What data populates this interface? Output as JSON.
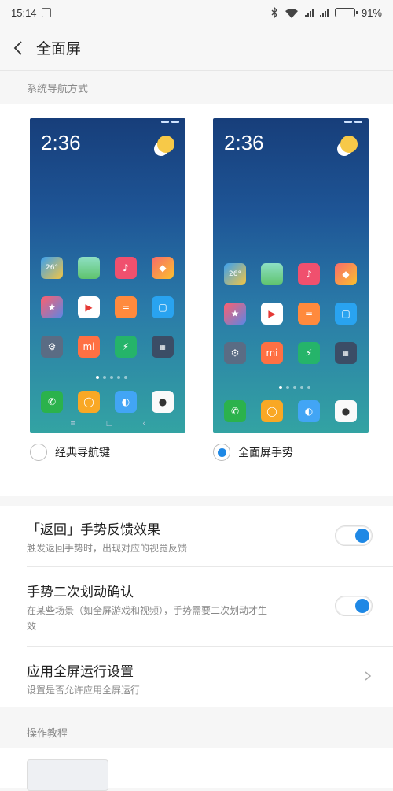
{
  "status_bar": {
    "time": "15:14",
    "battery": "91%",
    "battery_level": 0.91
  },
  "header": {
    "title": "全面屏"
  },
  "nav_section": {
    "label": "系统导航方式",
    "preview_time": "2:36",
    "app_badge_temp": "26°",
    "options": [
      {
        "label": "经典导航键",
        "selected": false
      },
      {
        "label": "全面屏手势",
        "selected": true
      }
    ]
  },
  "settings": [
    {
      "title": "「返回」手势反馈效果",
      "subtitle": "触发返回手势时，出现对应的视觉反馈",
      "toggle": true
    },
    {
      "title": "手势二次划动确认",
      "subtitle": "在某些场景（如全屏游戏和视频），手势需要二次划动才生效",
      "toggle": true
    },
    {
      "title": "应用全屏运行设置",
      "subtitle": "设置是否允许应用全屏运行",
      "chevron": true
    }
  ],
  "tutorial_section": {
    "label": "操作教程"
  },
  "colors": {
    "accent": "#1e88e5",
    "background": "#f6f6f6"
  }
}
